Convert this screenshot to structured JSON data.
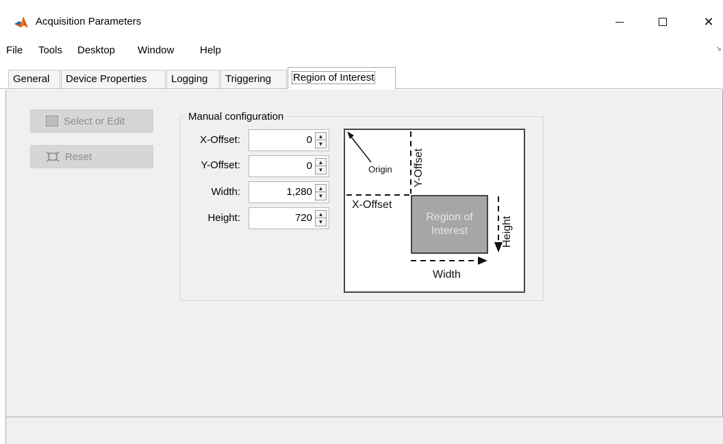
{
  "window": {
    "title": "Acquisition Parameters",
    "accent_color": "#d95319"
  },
  "menu": {
    "items": [
      "File",
      "Tools",
      "Desktop",
      "Window",
      "Help"
    ]
  },
  "tabs": [
    {
      "label": "General"
    },
    {
      "label": "Device Properties"
    },
    {
      "label": "Logging"
    },
    {
      "label": "Triggering"
    },
    {
      "label": "Region of Interest",
      "active": true
    }
  ],
  "actions": {
    "select_edit_label": "Select or Edit",
    "reset_label": "Reset"
  },
  "manual_config": {
    "title": "Manual configuration",
    "fields": [
      {
        "label": "X-Offset:",
        "value": "0"
      },
      {
        "label": "Y-Offset:",
        "value": "0"
      },
      {
        "label": "Width:",
        "value": "1,280"
      },
      {
        "label": "Height:",
        "value": "720"
      }
    ]
  },
  "diagram": {
    "origin_label": "Origin",
    "y_offset_label": "Y-Offset",
    "x_offset_label": "X-Offset",
    "roi_label_line1": "Region of",
    "roi_label_line2": "Interest",
    "height_label": "Height",
    "width_label": "Width"
  }
}
